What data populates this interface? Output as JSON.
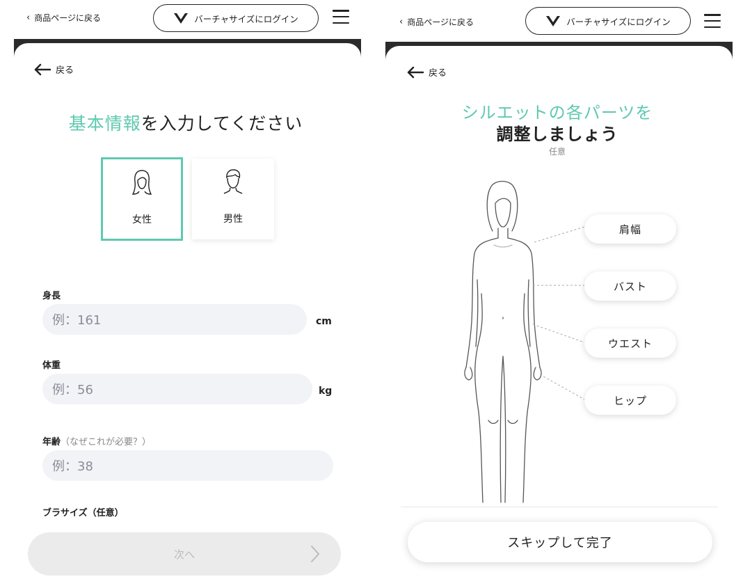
{
  "left": {
    "topbar": {
      "back_label": "商品ページに戻る",
      "login_label": "バーチャサイズにログイン"
    },
    "back_label": "戻る",
    "title_accent": "基本情報",
    "title_rest": "を入力してください",
    "gender": {
      "female_label": "女性",
      "male_label": "男性",
      "selected": "female"
    },
    "fields": {
      "height": {
        "label": "身長",
        "placeholder": "例：161",
        "unit": "cm"
      },
      "weight": {
        "label": "体重",
        "placeholder": "例：56",
        "unit": "kg"
      },
      "age": {
        "label": "年齢",
        "hint": "（なぜこれが必要？）",
        "placeholder": "例：38"
      },
      "bra": {
        "label": "ブラサイズ（任意）"
      }
    },
    "next_label": "次へ"
  },
  "right": {
    "topbar": {
      "back_label": "商品ページに戻る",
      "login_label": "バーチャサイズにログイン"
    },
    "back_label": "戻る",
    "title_line1": "シルエットの各パーツを",
    "title_line2": "調整しましょう",
    "subtitle": "任意",
    "parts": [
      "肩幅",
      "バスト",
      "ウエスト",
      "ヒップ"
    ],
    "skip_label": "スキップして完了"
  },
  "colors": {
    "accent": "#5ec9b0",
    "text": "#222222",
    "input_bg": "#f2f3f7",
    "disabled_bg": "#ebebeb"
  }
}
